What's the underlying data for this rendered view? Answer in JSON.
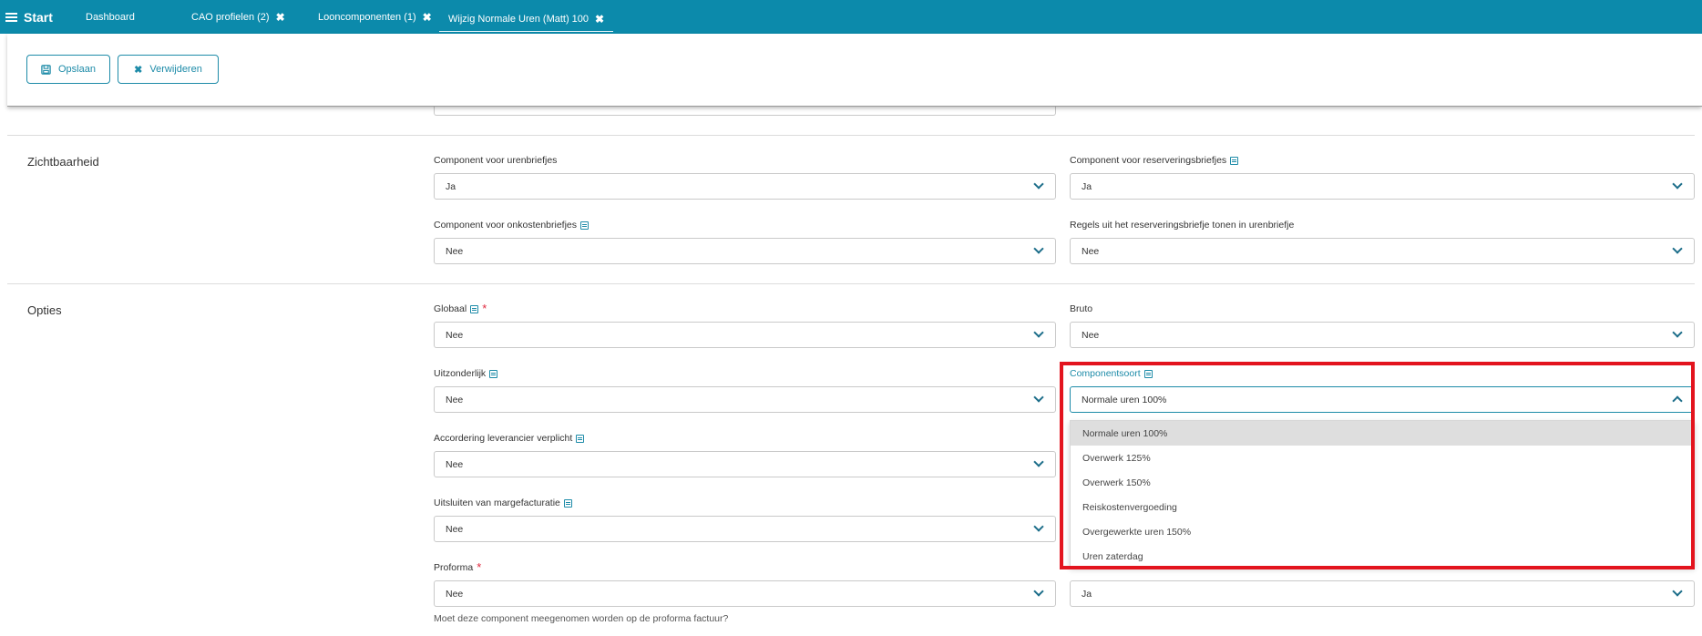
{
  "topbar": {
    "start_label": "Start",
    "tabs": [
      {
        "label": "Dashboard",
        "closable": false
      },
      {
        "label": "CAO profielen (2)",
        "closable": true
      },
      {
        "label": "Looncomponenten (1)",
        "closable": true
      },
      {
        "label": "Wijzig Normale Uren (Matt) 100",
        "closable": true,
        "active": true
      }
    ],
    "close_glyph": "✖"
  },
  "toolbar": {
    "save_label": "Opslaan",
    "delete_label": "Verwijderen"
  },
  "sections": {
    "zichtbaarheid": {
      "title": "Zichtbaarheid",
      "fields": {
        "urenbriefjes": {
          "label": "Component voor urenbriefjes",
          "value": "Ja"
        },
        "reserveringsbriefjes": {
          "label": "Component voor reserveringsbriefjes",
          "value": "Ja"
        },
        "onkostenbriefjes": {
          "label": "Component voor onkostenbriefjes",
          "value": "Nee"
        },
        "regels_tonen": {
          "label": "Regels uit het reserveringsbriefje tonen in urenbriefje",
          "value": "Nee"
        }
      }
    },
    "opties": {
      "title": "Opties",
      "fields": {
        "globaal": {
          "label": "Globaal",
          "value": "Nee"
        },
        "bruto": {
          "label": "Bruto",
          "value": "Nee"
        },
        "uitzonderlijk": {
          "label": "Uitzonderlijk",
          "value": "Nee"
        },
        "componentsoort": {
          "label": "Componentsoort",
          "value": "Normale uren 100%"
        },
        "accordering": {
          "label": "Accordering leverancier verplicht",
          "value": "Nee"
        },
        "margefacturatie": {
          "label": "Uitsluiten van margefacturatie",
          "value": "Nee"
        },
        "proforma": {
          "label": "Proforma",
          "value": "Nee",
          "help": "Moet deze component meegenomen worden op de proforma factuur?"
        },
        "hidden_right": {
          "value": "Ja"
        }
      }
    }
  },
  "dropdown": {
    "options": [
      "Normale uren 100%",
      "Overwerk 125%",
      "Overwerk 150%",
      "Reiskostenvergoeding",
      "Overgewerkte uren 150%",
      "Uren zaterdag"
    ],
    "selected_index": 0
  },
  "colors": {
    "topbar": "#0c8aab",
    "accent": "#1d8ba8",
    "required": "#e0293f",
    "highlight": "#e3141e"
  }
}
